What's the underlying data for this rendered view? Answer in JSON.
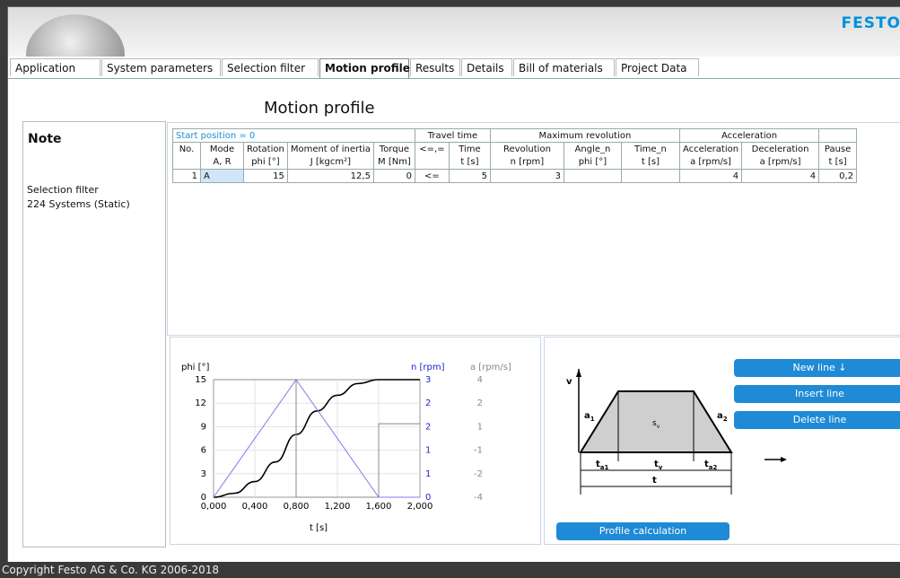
{
  "brand": "FESTO",
  "tabs": [
    "Application",
    "System parameters",
    "Selection filter",
    "Motion profile",
    "Results",
    "Details",
    "Bill of materials",
    "Project Data"
  ],
  "active_tab": "Motion profile",
  "page_title": "Motion profile",
  "note": {
    "title": "Note",
    "line1": "Selection filter",
    "line2": "224 Systems (Static)"
  },
  "table": {
    "start_position": "Start position = 0",
    "groups": {
      "travel_time": "Travel time",
      "max_revolution": "Maximum revolution",
      "acceleration": "Acceleration"
    },
    "headers_row1": [
      "No.",
      "Mode",
      "Rotation",
      "Moment of inertia",
      "Torque",
      "<=,=",
      "Time",
      "Revolution",
      "Angle_n",
      "Time_n",
      "Acceleration",
      "Deceleration",
      "Pause"
    ],
    "headers_row2": [
      "",
      "A, R",
      "phi [°]",
      "J [kgcm²]",
      "M [Nm]",
      "",
      "t [s]",
      "n [rpm]",
      "phi [°]",
      "t [s]",
      "a [rpm/s]",
      "a [rpm/s]",
      "t [s]"
    ],
    "rows": [
      [
        "1",
        "A",
        "15",
        "12,5",
        "0",
        "<=",
        "5",
        "3",
        "",
        "",
        "4",
        "4",
        "0,2"
      ]
    ]
  },
  "chart_labels": {
    "left_unit": "phi [°]",
    "mid_unit": "n [rpm]",
    "right_unit": "a [rpm/s]",
    "xlabel": "t [s]",
    "x_ticks": [
      "0,000",
      "0,400",
      "0,800",
      "1,200",
      "1,600",
      "2,000"
    ],
    "phi_ticks": [
      "0",
      "3",
      "6",
      "9",
      "12",
      "15"
    ],
    "n_ticks": [
      "0",
      "1",
      "1",
      "2",
      "2",
      "3"
    ],
    "a_ticks": [
      "-4",
      "-2",
      "-1",
      "1",
      "2",
      "4"
    ]
  },
  "chart_data": {
    "type": "line",
    "xlabel": "t [s]",
    "xlim": [
      0,
      2.0
    ],
    "series": [
      {
        "name": "phi [°]",
        "axis": "phi",
        "x": [
          0,
          0.2,
          0.4,
          0.6,
          0.8,
          1.0,
          1.2,
          1.4,
          1.6,
          1.8,
          2.0
        ],
        "y": [
          0,
          0.5,
          2,
          4.5,
          8,
          11,
          13,
          14.5,
          15,
          15,
          15
        ]
      },
      {
        "name": "n [rpm]",
        "axis": "n",
        "x": [
          0,
          0.8,
          1.6,
          2.0
        ],
        "y": [
          0,
          3,
          0,
          0
        ]
      },
      {
        "name": "a [rpm/s]",
        "axis": "a",
        "x": [
          0,
          0.8,
          0.8,
          1.6,
          1.6,
          2.0
        ],
        "y": [
          4,
          4,
          -4,
          -4,
          1,
          1
        ]
      }
    ],
    "phi_lim": [
      0,
      15
    ],
    "n_lim": [
      0,
      3
    ],
    "a_lim": [
      -4,
      4
    ]
  },
  "diagram": {
    "v": "v",
    "a1": "a",
    "a1_sub": "1",
    "a2": "a",
    "a2_sub": "2",
    "sv": "s",
    "sv_sub": "v",
    "ta1": "t",
    "ta1_sub": "a1",
    "tv": "t",
    "tv_sub": "v",
    "ta2": "t",
    "ta2_sub": "a2",
    "t": "t"
  },
  "buttons": {
    "new_line": "New line ↓",
    "insert_line": "Insert line",
    "delete_line": "Delete line",
    "profile_calculation": "Profile calculation"
  },
  "footer": "Copyright Festo AG & Co. KG 2006-2018",
  "colors": {
    "accent": "#1f8ad6",
    "brand": "#0091dc",
    "phi_curve": "#000000",
    "n_curve": "#7b7bf0",
    "a_curve": "#888888"
  }
}
